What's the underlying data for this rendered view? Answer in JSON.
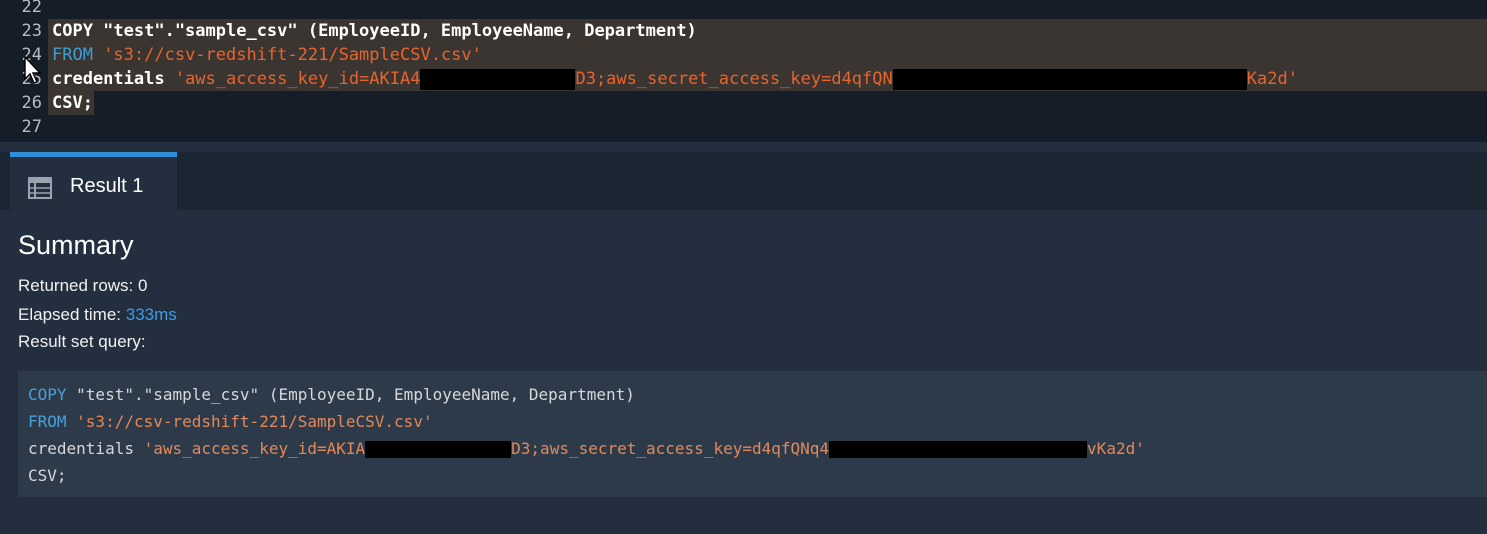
{
  "editor": {
    "lines": [
      {
        "num": "22"
      },
      {
        "num": "23",
        "p1": "COPY \"test\".\"sample_csv\" (EmployeeID, EmployeeName, Department)"
      },
      {
        "num": "24",
        "kw": "FROM",
        "str": " 's3://csv-redshift-221/SampleCSV.csv'"
      },
      {
        "num": "25",
        "kw": "credentials",
        "s1": " 'aws_access_key_id=AKIA4",
        "s2": "D3;aws_secret_access_key=d4qfQN",
        "s3": "Ka2d'"
      },
      {
        "num": "26",
        "p1": "CSV;"
      },
      {
        "num": "27"
      }
    ]
  },
  "tabs": [
    {
      "label": "Result 1",
      "icon": "table-icon"
    }
  ],
  "summary": {
    "title": "Summary",
    "returned_rows_label": "Returned rows: 0",
    "elapsed_label": "Elapsed time:",
    "elapsed_value": "333ms",
    "result_query_label": "Result set query:"
  },
  "result_query": {
    "l1_kw": "COPY",
    "l1_rest": " \"test\".\"sample_csv\" (EmployeeID, EmployeeName, Department)",
    "l2_kw": "FROM",
    "l2_str": " 's3://csv-redshift-221/SampleCSV.csv'",
    "l3_plain": "credentials ",
    "l3_s1": "'aws_access_key_id=AKIA",
    "l3_s2": "D3;aws_secret_access_key=d4qfQNq4",
    "l3_s3": "vKa2d'",
    "l4": "CSV;"
  },
  "colors": {
    "accent": "#2f8fd8",
    "string": "#e8642e",
    "keyword": "#3e9dd6"
  }
}
